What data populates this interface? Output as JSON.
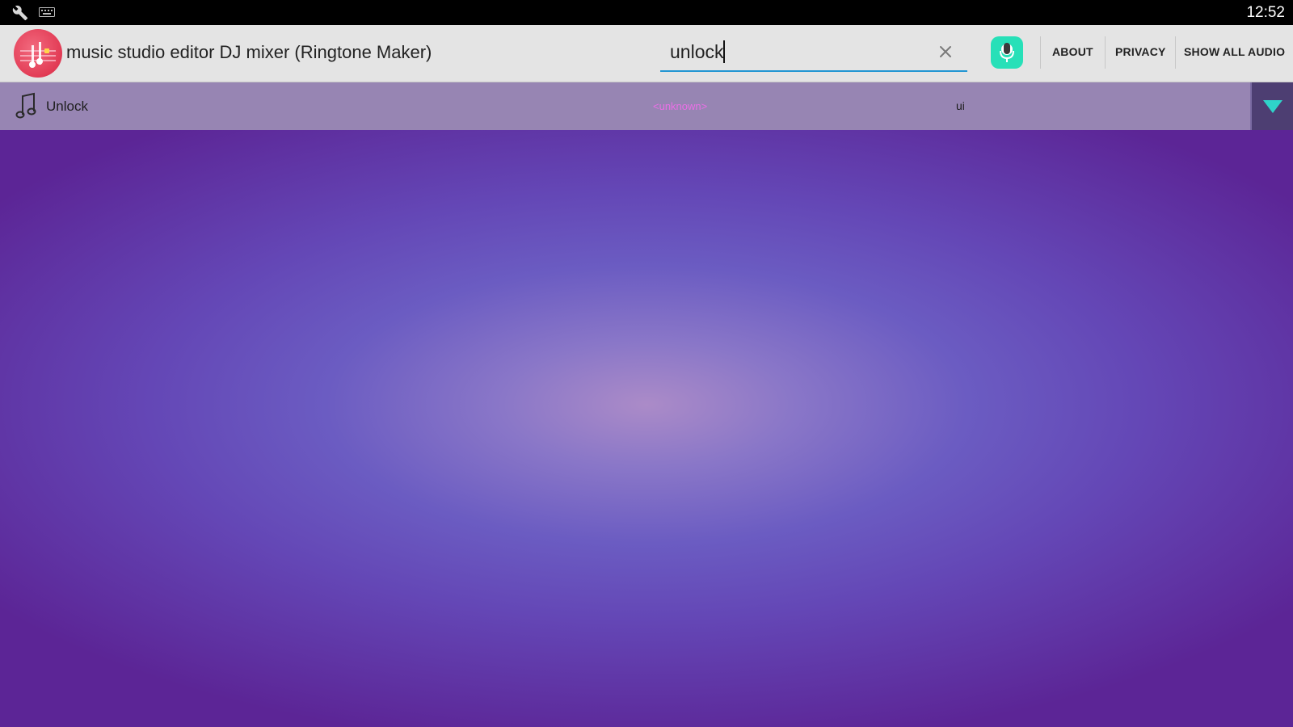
{
  "status_bar": {
    "time": "12:52",
    "icons": [
      "wrench-icon",
      "keyboard-icon"
    ]
  },
  "app_bar": {
    "title": "music studio editor DJ mixer (Ringtone Maker)",
    "logo_icon": "app-logo-icon",
    "search": {
      "value": "unlock",
      "clear_icon": "close-icon"
    },
    "mic_icon": "microphone-icon",
    "actions": {
      "about": "ABOUT",
      "privacy": "PRIVACY",
      "show_all_audio": "SHOW ALL AUDIO"
    }
  },
  "results": [
    {
      "icon": "music-note-icon",
      "title": "Unlock",
      "artist": "<unknown>",
      "album": "ui",
      "menu_icon": "dropdown-triangle-icon"
    }
  ],
  "colors": {
    "accent": "#2196d3",
    "mic_button": "#27e0b8",
    "row_background": "#9785b3",
    "artist_text": "#ea6fe6",
    "menu_button": "#4d3e72",
    "menu_triangle": "#2fd3c9",
    "background_center": "#ab8bc8",
    "background_edge": "#5c2596"
  }
}
